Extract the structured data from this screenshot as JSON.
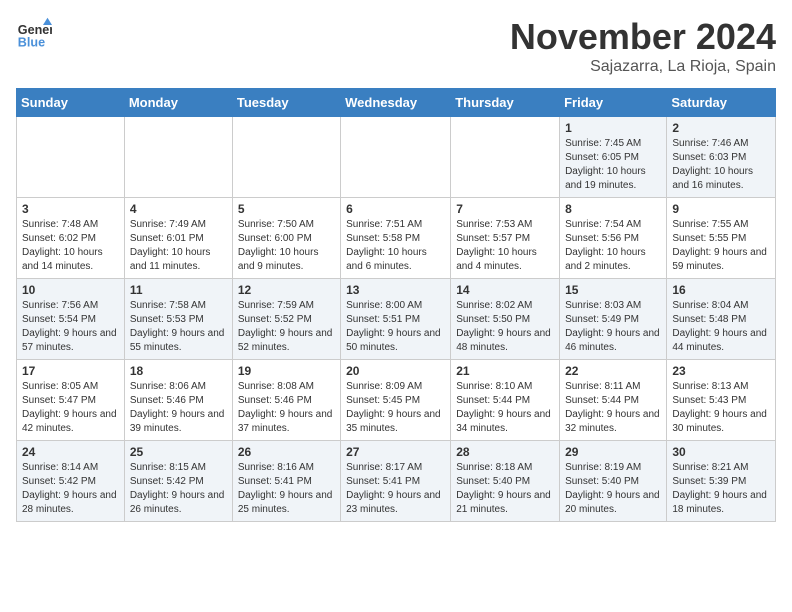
{
  "logo": {
    "text_general": "General",
    "text_blue": "Blue"
  },
  "title": "November 2024",
  "location": "Sajazarra, La Rioja, Spain",
  "days_of_week": [
    "Sunday",
    "Monday",
    "Tuesday",
    "Wednesday",
    "Thursday",
    "Friday",
    "Saturday"
  ],
  "weeks": [
    [
      {
        "day": "",
        "info": ""
      },
      {
        "day": "",
        "info": ""
      },
      {
        "day": "",
        "info": ""
      },
      {
        "day": "",
        "info": ""
      },
      {
        "day": "",
        "info": ""
      },
      {
        "day": "1",
        "info": "Sunrise: 7:45 AM\nSunset: 6:05 PM\nDaylight: 10 hours and 19 minutes."
      },
      {
        "day": "2",
        "info": "Sunrise: 7:46 AM\nSunset: 6:03 PM\nDaylight: 10 hours and 16 minutes."
      }
    ],
    [
      {
        "day": "3",
        "info": "Sunrise: 7:48 AM\nSunset: 6:02 PM\nDaylight: 10 hours and 14 minutes."
      },
      {
        "day": "4",
        "info": "Sunrise: 7:49 AM\nSunset: 6:01 PM\nDaylight: 10 hours and 11 minutes."
      },
      {
        "day": "5",
        "info": "Sunrise: 7:50 AM\nSunset: 6:00 PM\nDaylight: 10 hours and 9 minutes."
      },
      {
        "day": "6",
        "info": "Sunrise: 7:51 AM\nSunset: 5:58 PM\nDaylight: 10 hours and 6 minutes."
      },
      {
        "day": "7",
        "info": "Sunrise: 7:53 AM\nSunset: 5:57 PM\nDaylight: 10 hours and 4 minutes."
      },
      {
        "day": "8",
        "info": "Sunrise: 7:54 AM\nSunset: 5:56 PM\nDaylight: 10 hours and 2 minutes."
      },
      {
        "day": "9",
        "info": "Sunrise: 7:55 AM\nSunset: 5:55 PM\nDaylight: 9 hours and 59 minutes."
      }
    ],
    [
      {
        "day": "10",
        "info": "Sunrise: 7:56 AM\nSunset: 5:54 PM\nDaylight: 9 hours and 57 minutes."
      },
      {
        "day": "11",
        "info": "Sunrise: 7:58 AM\nSunset: 5:53 PM\nDaylight: 9 hours and 55 minutes."
      },
      {
        "day": "12",
        "info": "Sunrise: 7:59 AM\nSunset: 5:52 PM\nDaylight: 9 hours and 52 minutes."
      },
      {
        "day": "13",
        "info": "Sunrise: 8:00 AM\nSunset: 5:51 PM\nDaylight: 9 hours and 50 minutes."
      },
      {
        "day": "14",
        "info": "Sunrise: 8:02 AM\nSunset: 5:50 PM\nDaylight: 9 hours and 48 minutes."
      },
      {
        "day": "15",
        "info": "Sunrise: 8:03 AM\nSunset: 5:49 PM\nDaylight: 9 hours and 46 minutes."
      },
      {
        "day": "16",
        "info": "Sunrise: 8:04 AM\nSunset: 5:48 PM\nDaylight: 9 hours and 44 minutes."
      }
    ],
    [
      {
        "day": "17",
        "info": "Sunrise: 8:05 AM\nSunset: 5:47 PM\nDaylight: 9 hours and 42 minutes."
      },
      {
        "day": "18",
        "info": "Sunrise: 8:06 AM\nSunset: 5:46 PM\nDaylight: 9 hours and 39 minutes."
      },
      {
        "day": "19",
        "info": "Sunrise: 8:08 AM\nSunset: 5:46 PM\nDaylight: 9 hours and 37 minutes."
      },
      {
        "day": "20",
        "info": "Sunrise: 8:09 AM\nSunset: 5:45 PM\nDaylight: 9 hours and 35 minutes."
      },
      {
        "day": "21",
        "info": "Sunrise: 8:10 AM\nSunset: 5:44 PM\nDaylight: 9 hours and 34 minutes."
      },
      {
        "day": "22",
        "info": "Sunrise: 8:11 AM\nSunset: 5:44 PM\nDaylight: 9 hours and 32 minutes."
      },
      {
        "day": "23",
        "info": "Sunrise: 8:13 AM\nSunset: 5:43 PM\nDaylight: 9 hours and 30 minutes."
      }
    ],
    [
      {
        "day": "24",
        "info": "Sunrise: 8:14 AM\nSunset: 5:42 PM\nDaylight: 9 hours and 28 minutes."
      },
      {
        "day": "25",
        "info": "Sunrise: 8:15 AM\nSunset: 5:42 PM\nDaylight: 9 hours and 26 minutes."
      },
      {
        "day": "26",
        "info": "Sunrise: 8:16 AM\nSunset: 5:41 PM\nDaylight: 9 hours and 25 minutes."
      },
      {
        "day": "27",
        "info": "Sunrise: 8:17 AM\nSunset: 5:41 PM\nDaylight: 9 hours and 23 minutes."
      },
      {
        "day": "28",
        "info": "Sunrise: 8:18 AM\nSunset: 5:40 PM\nDaylight: 9 hours and 21 minutes."
      },
      {
        "day": "29",
        "info": "Sunrise: 8:19 AM\nSunset: 5:40 PM\nDaylight: 9 hours and 20 minutes."
      },
      {
        "day": "30",
        "info": "Sunrise: 8:21 AM\nSunset: 5:39 PM\nDaylight: 9 hours and 18 minutes."
      }
    ]
  ]
}
